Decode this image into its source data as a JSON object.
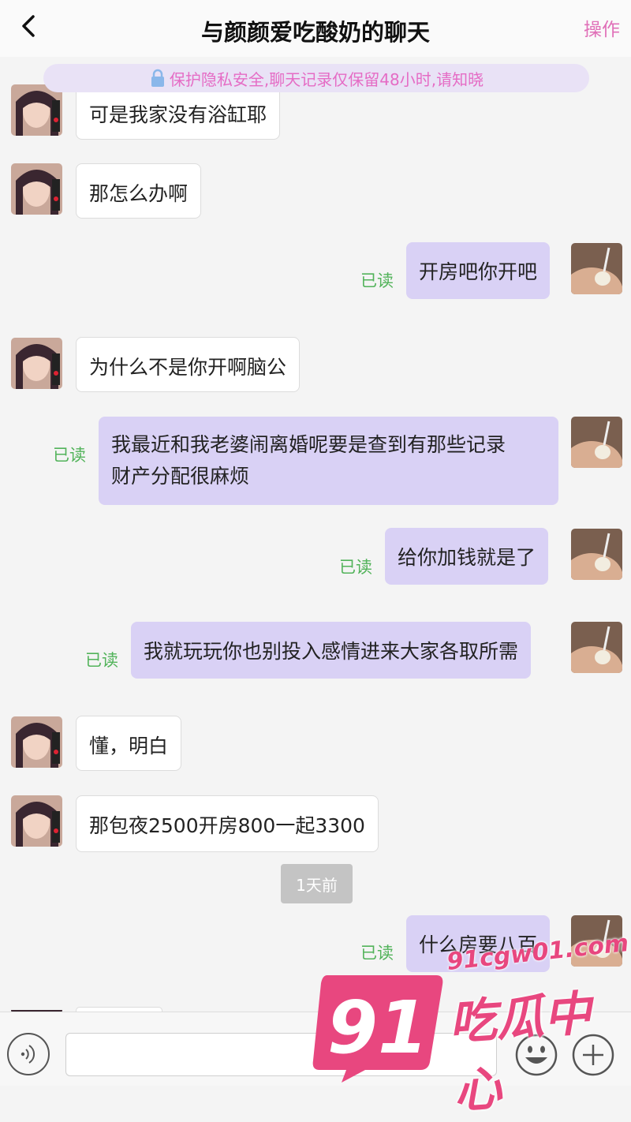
{
  "header": {
    "title": "与颜颜爱吃酸奶的聊天",
    "action_label": "操作"
  },
  "notice": {
    "text": "保护隐私安全,聊天记录仅保留48小时,请知晓"
  },
  "messages": [
    {
      "side": "left",
      "text": "可是我家没有浴缸耶"
    },
    {
      "side": "left",
      "text": "那怎么办啊"
    },
    {
      "side": "right",
      "text": "开房吧你开吧",
      "status": "已读"
    },
    {
      "side": "left",
      "text": "为什么不是你开啊脑公"
    },
    {
      "side": "right",
      "text_line1": "我最近和我老婆闹离婚呢要是查到有那些记录",
      "text_line2": "财产分配很麻烦",
      "status": "已读"
    },
    {
      "side": "right",
      "text": "给你加钱就是了",
      "status": "已读"
    },
    {
      "side": "right",
      "text": "我就玩玩你也别投入感情进来大家各取所需",
      "status": "已读"
    },
    {
      "side": "left",
      "text": "懂，明白"
    },
    {
      "side": "left",
      "text": "那包夜2500开房800一起3300"
    },
    {
      "side": "right",
      "text": "什么房要八百",
      "status": "已读"
    }
  ],
  "time_divider": "1天前",
  "input": {
    "placeholder": ""
  },
  "icons": {
    "back": "chevron-left-icon",
    "lock": "lock-icon",
    "voice": "voice-icon",
    "emoji": "smiley-icon",
    "plus": "plus-icon"
  },
  "watermark": {
    "domain": "91cgw01.com",
    "logo_number": "91",
    "name": "吃瓜中心"
  },
  "colors": {
    "accent": "#e070b8",
    "bubble_self": "#d9d1f5",
    "read_status": "#52b35a",
    "watermark": "#e8477f"
  }
}
